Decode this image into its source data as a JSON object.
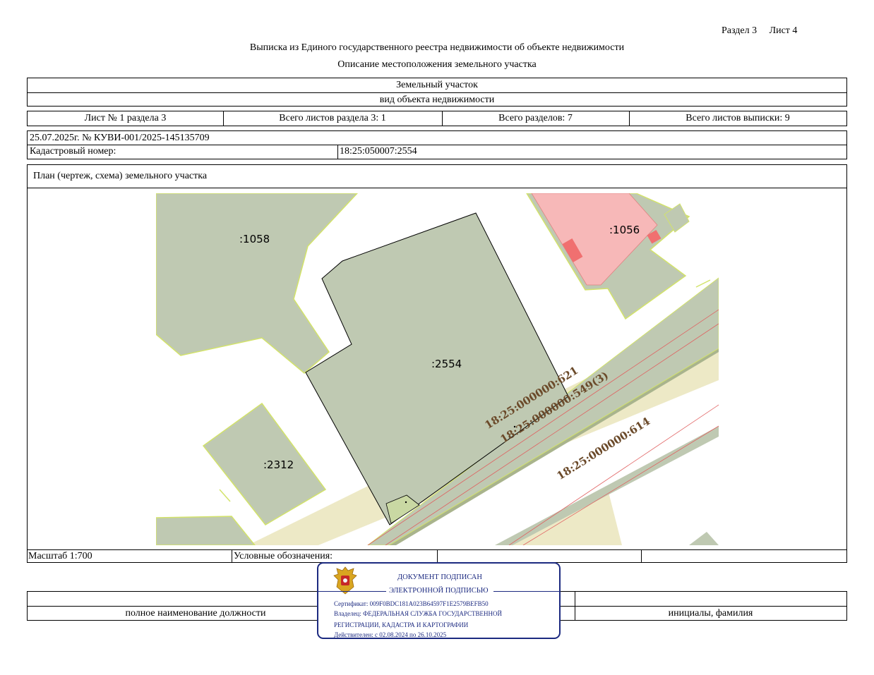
{
  "header": {
    "section": "Раздел 3",
    "sheet": "Лист 4"
  },
  "title": "Выписка из Единого государственного реестра недвижимости об объекте недвижимости",
  "subtitle": "Описание местоположения земельного участка",
  "object": {
    "name": "Земельный участок",
    "caption": "вид объекта недвижимости"
  },
  "sheet_row": {
    "sheet_of_section": "Лист № 1 раздела 3",
    "total_sheets_section": "Всего листов раздела 3: 1",
    "total_sections": "Всего разделов: 7",
    "total_sheets_extract": "Всего листов выписки: 9"
  },
  "doc_ref": "25.07.2025г. № КУВИ-001/2025-145135709",
  "cadastral": {
    "label": "Кадастровый номер:",
    "value": "18:25:050007:2554"
  },
  "plan_heading": "План (чертеж, схема) земельного участка",
  "map": {
    "parcels": [
      ":1058",
      ":2554",
      ":1056",
      ":2312"
    ],
    "roads": [
      "18:25:000000:621",
      "18:25:000000:549(3)",
      "18:25:000000:614"
    ],
    "colors": {
      "parcel": "#bfc9b2",
      "parcel_edge": "#d3e36a",
      "road": "#ede9c6",
      "neighbor": "#f7b8b8",
      "building": "#f07070"
    }
  },
  "scale_row": {
    "scale": "Масштаб 1:700",
    "legend": "Условные обозначения:"
  },
  "bottom_row": {
    "position_caption": "полное наименование должности",
    "name_caption": "инициалы, фамилия"
  },
  "stamp": {
    "line1": "ДОКУМЕНТ ПОДПИСАН",
    "line2": "ЭЛЕКТРОННОЙ ПОДПИСЬЮ",
    "cert": "Сертификат: 009F0BDC181A023B64597F1E2579BEFB50",
    "owner1": "Владелец: ФЕДЕРАЛЬНАЯ СЛУЖБА ГОСУДАРСТВЕННОЙ",
    "owner2": "РЕГИСТРАЦИИ, КАДАСТРА И КАРТОГРАФИИ",
    "valid": "Действителен: с 02.08.2024 по 26.10.2025",
    "emblem": "coat-of-arms-icon"
  }
}
